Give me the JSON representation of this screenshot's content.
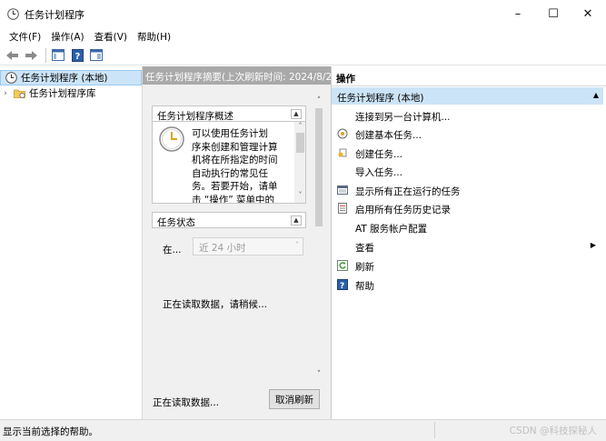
{
  "window": {
    "title": "任务计划程序",
    "minimize_glyph": "–",
    "maximize_glyph": "☐",
    "close_glyph": "✕"
  },
  "menubar": [
    {
      "label": "文件(F)"
    },
    {
      "label": "操作(A)"
    },
    {
      "label": "查看(V)"
    },
    {
      "label": "帮助(H)"
    }
  ],
  "toolbar": {
    "icons": [
      "back-arrow-icon",
      "forward-arrow-icon",
      "show-hide-console-tree-icon",
      "help-icon",
      "show-hide-action-pane-icon"
    ]
  },
  "tree": {
    "items": [
      {
        "label": "任务计划程序 (本地)",
        "icon": "clock-icon",
        "selected": true
      },
      {
        "label": "任务计划程序库",
        "icon": "folder-icon",
        "selected": false
      }
    ]
  },
  "center": {
    "header": "任务计划程序摘要(上次刷新时间: 2024/8/2",
    "overview": {
      "title": "任务计划程序概述",
      "description_lines": [
        "可以使用任务计划",
        "序来创建和管理计算",
        "机将在所指定的时间",
        "自动执行的常见任",
        "务。若要开始，请单",
        "击 “操作” 菜单中的"
      ]
    },
    "task_status": {
      "title": "任务状态",
      "in_label": "在...",
      "range_value": "近 24 小时",
      "loading_text": "正在读取数据，请稍候..."
    },
    "footer_text": "正在读取数据...",
    "cancel_refresh": "取消刷新"
  },
  "actions": {
    "header": "操作",
    "group": "任务计划程序 (本地)",
    "items": [
      {
        "label": "连接到另一台计算机...",
        "icon": ""
      },
      {
        "label": "创建基本任务...",
        "icon": "create-basic-task-icon"
      },
      {
        "label": "创建任务...",
        "icon": "create-task-icon"
      },
      {
        "label": "导入任务...",
        "icon": ""
      },
      {
        "label": "显示所有正在运行的任务",
        "icon": "running-tasks-icon"
      },
      {
        "label": "启用所有任务历史记录",
        "icon": "history-icon"
      },
      {
        "label": "AT 服务帐户配置",
        "icon": ""
      },
      {
        "label": "查看",
        "icon": "",
        "submenu": true
      },
      {
        "label": "刷新",
        "icon": "refresh-icon"
      },
      {
        "label": "帮助",
        "icon": "help-icon"
      }
    ]
  },
  "statusbar": {
    "text": "显示当前选择的帮助。",
    "watermark": "CSDN @科技探秘人"
  },
  "colors": {
    "selection": "#cce4f7",
    "center_header": "#a9a9a9",
    "pane_bg": "#f0f0f0"
  }
}
